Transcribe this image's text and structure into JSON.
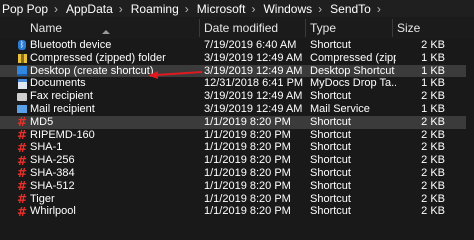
{
  "breadcrumb": [
    "Pop Pop",
    "AppData",
    "Roaming",
    "Microsoft",
    "Windows",
    "SendTo"
  ],
  "columns": {
    "name": "Name",
    "date": "Date modified",
    "type": "Type",
    "size": "Size"
  },
  "files": [
    {
      "name": "Bluetooth device",
      "date": "7/19/2019 6:40 AM",
      "type": "Shortcut",
      "size": "2 KB",
      "icon": "bluetooth-icon"
    },
    {
      "name": "Compressed (zipped) folder",
      "date": "3/19/2019 12:49 AM",
      "type": "Compressed (zipp...",
      "size": "1 KB",
      "icon": "zip-folder-icon"
    },
    {
      "name": "Desktop (create shortcut)",
      "date": "3/19/2019 12:49 AM",
      "type": "Desktop Shortcut",
      "size": "1 KB",
      "icon": "desktop-icon"
    },
    {
      "name": "Documents",
      "date": "12/31/2018 6:41 PM",
      "type": "MyDocs Drop Ta...",
      "size": "1 KB",
      "icon": "documents-icon"
    },
    {
      "name": "Fax recipient",
      "date": "3/19/2019 12:49 AM",
      "type": "Shortcut",
      "size": "2 KB",
      "icon": "fax-icon"
    },
    {
      "name": "Mail recipient",
      "date": "3/19/2019 12:49 AM",
      "type": "Mail Service",
      "size": "1 KB",
      "icon": "mail-icon"
    },
    {
      "name": "MD5",
      "date": "1/1/2019 8:20 PM",
      "type": "Shortcut",
      "size": "2 KB",
      "icon": "hash-icon"
    },
    {
      "name": "RIPEMD-160",
      "date": "1/1/2019 8:20 PM",
      "type": "Shortcut",
      "size": "2 KB",
      "icon": "hash-icon"
    },
    {
      "name": "SHA-1",
      "date": "1/1/2019 8:20 PM",
      "type": "Shortcut",
      "size": "2 KB",
      "icon": "hash-icon"
    },
    {
      "name": "SHA-256",
      "date": "1/1/2019 8:20 PM",
      "type": "Shortcut",
      "size": "2 KB",
      "icon": "hash-icon"
    },
    {
      "name": "SHA-384",
      "date": "1/1/2019 8:20 PM",
      "type": "Shortcut",
      "size": "2 KB",
      "icon": "hash-icon"
    },
    {
      "name": "SHA-512",
      "date": "1/1/2019 8:20 PM",
      "type": "Shortcut",
      "size": "2 KB",
      "icon": "hash-icon"
    },
    {
      "name": "Tiger",
      "date": "1/1/2019 8:20 PM",
      "type": "Shortcut",
      "size": "2 KB",
      "icon": "hash-icon"
    },
    {
      "name": "Whirlpool",
      "date": "1/1/2019 8:20 PM",
      "type": "Shortcut",
      "size": "2 KB",
      "icon": "hash-icon"
    }
  ],
  "highlighted_rows": {
    "hover": 2,
    "selected": 6
  },
  "colors": {
    "background": "#191919",
    "annotation_arrow": "#e0191f",
    "hash_icon": "#e8302a"
  }
}
